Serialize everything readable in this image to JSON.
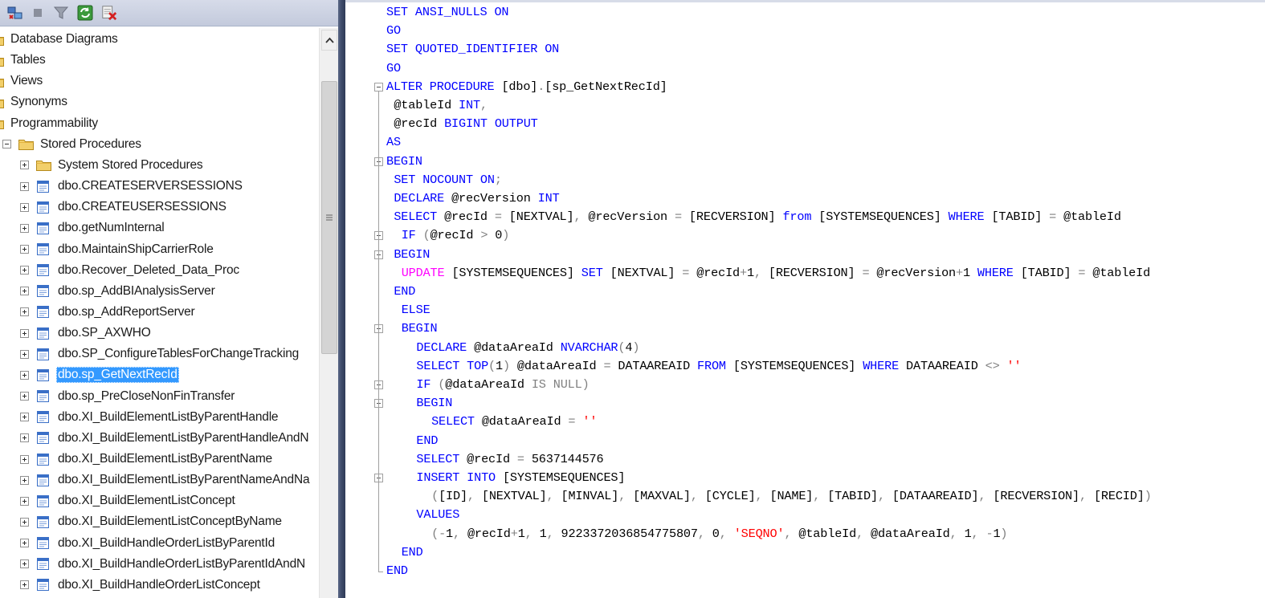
{
  "explorer": {
    "toolbar": {
      "buttons": [
        "connect-icon",
        "stop-icon",
        "filter-icon",
        "refresh-icon",
        "delete-icon"
      ]
    },
    "tree": [
      {
        "label": "Database Diagrams",
        "kind": "folder",
        "level": 0,
        "expander": "none"
      },
      {
        "label": "Tables",
        "kind": "folder",
        "level": 0,
        "expander": "none"
      },
      {
        "label": "Views",
        "kind": "folder",
        "level": 0,
        "expander": "none"
      },
      {
        "label": "Synonyms",
        "kind": "folder",
        "level": 0,
        "expander": "none"
      },
      {
        "label": "Programmability",
        "kind": "folder",
        "level": 0,
        "expander": "none"
      },
      {
        "label": "Stored Procedures",
        "kind": "folder",
        "level": 1,
        "expander": "minus"
      },
      {
        "label": "System Stored Procedures",
        "kind": "folder",
        "level": 2,
        "expander": "plus"
      },
      {
        "label": "dbo.CREATESERVERSESSIONS",
        "kind": "proc",
        "level": 2,
        "expander": "plus"
      },
      {
        "label": "dbo.CREATEUSERSESSIONS",
        "kind": "proc",
        "level": 2,
        "expander": "plus"
      },
      {
        "label": "dbo.getNumInternal",
        "kind": "proc",
        "level": 2,
        "expander": "plus"
      },
      {
        "label": "dbo.MaintainShipCarrierRole",
        "kind": "proc",
        "level": 2,
        "expander": "plus"
      },
      {
        "label": "dbo.Recover_Deleted_Data_Proc",
        "kind": "proc",
        "level": 2,
        "expander": "plus"
      },
      {
        "label": "dbo.sp_AddBIAnalysisServer",
        "kind": "proc",
        "level": 2,
        "expander": "plus"
      },
      {
        "label": "dbo.sp_AddReportServer",
        "kind": "proc",
        "level": 2,
        "expander": "plus"
      },
      {
        "label": "dbo.SP_AXWHO",
        "kind": "proc",
        "level": 2,
        "expander": "plus"
      },
      {
        "label": "dbo.SP_ConfigureTablesForChangeTracking",
        "kind": "proc",
        "level": 2,
        "expander": "plus"
      },
      {
        "label": "dbo.sp_GetNextRecId",
        "kind": "proc",
        "level": 2,
        "expander": "plus",
        "selected": true
      },
      {
        "label": "dbo.sp_PreCloseNonFinTransfer",
        "kind": "proc",
        "level": 2,
        "expander": "plus"
      },
      {
        "label": "dbo.XI_BuildElementListByParentHandle",
        "kind": "proc",
        "level": 2,
        "expander": "plus"
      },
      {
        "label": "dbo.XI_BuildElementListByParentHandleAndN",
        "kind": "proc",
        "level": 2,
        "expander": "plus"
      },
      {
        "label": "dbo.XI_BuildElementListByParentName",
        "kind": "proc",
        "level": 2,
        "expander": "plus"
      },
      {
        "label": "dbo.XI_BuildElementListByParentNameAndNa",
        "kind": "proc",
        "level": 2,
        "expander": "plus"
      },
      {
        "label": "dbo.XI_BuildElementListConcept",
        "kind": "proc",
        "level": 2,
        "expander": "plus"
      },
      {
        "label": "dbo.XI_BuildElementListConceptByName",
        "kind": "proc",
        "level": 2,
        "expander": "plus"
      },
      {
        "label": "dbo.XI_BuildHandleOrderListByParentId",
        "kind": "proc",
        "level": 2,
        "expander": "plus"
      },
      {
        "label": "dbo.XI_BuildHandleOrderListByParentIdAndN",
        "kind": "proc",
        "level": 2,
        "expander": "plus"
      },
      {
        "label": "dbo.XI_BuildHandleOrderListConcept",
        "kind": "proc",
        "level": 2,
        "expander": "plus"
      }
    ]
  },
  "editor": {
    "lines": [
      {
        "indent": 0,
        "tokens": [
          [
            "kw",
            "SET ANSI_NULLS ON"
          ]
        ]
      },
      {
        "indent": 0,
        "tokens": [
          [
            "kw",
            "GO"
          ]
        ]
      },
      {
        "indent": 0,
        "tokens": [
          [
            "kw",
            "SET QUOTED_IDENTIFIER ON"
          ]
        ]
      },
      {
        "indent": 0,
        "tokens": [
          [
            "kw",
            "GO"
          ]
        ]
      },
      {
        "indent": 0,
        "fold": true,
        "tokens": [
          [
            "kw",
            "ALTER PROCEDURE "
          ],
          [
            "tx",
            "[dbo]"
          ],
          [
            "gy",
            "."
          ],
          [
            "tx",
            "[sp_GetNextRecId]"
          ]
        ]
      },
      {
        "indent": 1,
        "tokens": [
          [
            "tx",
            "@tableId "
          ],
          [
            "kw",
            "INT"
          ],
          [
            "gy",
            ","
          ]
        ]
      },
      {
        "indent": 1,
        "tokens": [
          [
            "tx",
            "@recId "
          ],
          [
            "kw",
            "BIGINT OUTPUT"
          ]
        ]
      },
      {
        "indent": 0,
        "tokens": [
          [
            "kw",
            "AS"
          ]
        ]
      },
      {
        "indent": 0,
        "fold": true,
        "tokens": [
          [
            "kw",
            "BEGIN"
          ]
        ]
      },
      {
        "indent": 1,
        "tokens": [
          [
            "kw",
            "SET NOCOUNT ON"
          ],
          [
            "gy",
            ";"
          ]
        ]
      },
      {
        "indent": 1,
        "tokens": [
          [
            "kw",
            "DECLARE "
          ],
          [
            "tx",
            "@recVersion "
          ],
          [
            "kw",
            "INT"
          ]
        ]
      },
      {
        "indent": 1,
        "tokens": [
          [
            "kw",
            "SELECT "
          ],
          [
            "tx",
            "@recId "
          ],
          [
            "gy",
            "= "
          ],
          [
            "tx",
            "[NEXTVAL]"
          ],
          [
            "gy",
            ", "
          ],
          [
            "tx",
            "@recVersion "
          ],
          [
            "gy",
            "= "
          ],
          [
            "tx",
            "[RECVERSION] "
          ],
          [
            "kw",
            "from "
          ],
          [
            "tx",
            "[SYSTEMSEQUENCES] "
          ],
          [
            "kw",
            "WHERE "
          ],
          [
            "tx",
            "[TABID] "
          ],
          [
            "gy",
            "= "
          ],
          [
            "tx",
            "@tableId"
          ]
        ]
      },
      {
        "indent": 2,
        "fold": true,
        "tokens": [
          [
            "kw",
            "IF "
          ],
          [
            "gy",
            "("
          ],
          [
            "tx",
            "@recId "
          ],
          [
            "gy",
            "> "
          ],
          [
            "tx",
            "0"
          ],
          [
            "gy",
            ")"
          ]
        ]
      },
      {
        "indent": 1,
        "fold": true,
        "tokens": [
          [
            "kw",
            "BEGIN"
          ]
        ]
      },
      {
        "indent": 2,
        "tokens": [
          [
            "pk",
            "UPDATE "
          ],
          [
            "tx",
            "[SYSTEMSEQUENCES] "
          ],
          [
            "kw",
            "SET "
          ],
          [
            "tx",
            "[NEXTVAL] "
          ],
          [
            "gy",
            "= "
          ],
          [
            "tx",
            "@recId"
          ],
          [
            "gy",
            "+"
          ],
          [
            "tx",
            "1"
          ],
          [
            "gy",
            ", "
          ],
          [
            "tx",
            "[RECVERSION] "
          ],
          [
            "gy",
            "= "
          ],
          [
            "tx",
            "@recVersion"
          ],
          [
            "gy",
            "+"
          ],
          [
            "tx",
            "1 "
          ],
          [
            "kw",
            "WHERE "
          ],
          [
            "tx",
            "[TABID] "
          ],
          [
            "gy",
            "= "
          ],
          [
            "tx",
            "@tableId"
          ]
        ]
      },
      {
        "indent": 1,
        "tokens": [
          [
            "kw",
            "END"
          ]
        ]
      },
      {
        "indent": 2,
        "tokens": [
          [
            "kw",
            "ELSE"
          ]
        ]
      },
      {
        "indent": 2,
        "fold": true,
        "tokens": [
          [
            "kw",
            "BEGIN"
          ]
        ]
      },
      {
        "indent": 4,
        "tokens": [
          [
            "kw",
            "DECLARE "
          ],
          [
            "tx",
            "@dataAreaId "
          ],
          [
            "kw",
            "NVARCHAR"
          ],
          [
            "gy",
            "("
          ],
          [
            "tx",
            "4"
          ],
          [
            "gy",
            ")"
          ]
        ]
      },
      {
        "indent": 4,
        "tokens": [
          [
            "kw",
            "SELECT TOP"
          ],
          [
            "gy",
            "("
          ],
          [
            "tx",
            "1"
          ],
          [
            "gy",
            ") "
          ],
          [
            "tx",
            "@dataAreaId "
          ],
          [
            "gy",
            "= "
          ],
          [
            "tx",
            "DATAAREAID "
          ],
          [
            "kw",
            "FROM "
          ],
          [
            "tx",
            "[SYSTEMSEQUENCES] "
          ],
          [
            "kw",
            "WHERE "
          ],
          [
            "tx",
            "DATAAREAID "
          ],
          [
            "gy",
            "<> "
          ],
          [
            "st",
            "''"
          ]
        ]
      },
      {
        "indent": 4,
        "fold": true,
        "tokens": [
          [
            "kw",
            "IF "
          ],
          [
            "gy",
            "("
          ],
          [
            "tx",
            "@dataAreaId "
          ],
          [
            "gy",
            "IS NULL)"
          ]
        ]
      },
      {
        "indent": 4,
        "fold": true,
        "tokens": [
          [
            "kw",
            "BEGIN"
          ]
        ]
      },
      {
        "indent": 6,
        "tokens": [
          [
            "kw",
            "SELECT "
          ],
          [
            "tx",
            "@dataAreaId "
          ],
          [
            "gy",
            "= "
          ],
          [
            "st",
            "''"
          ]
        ]
      },
      {
        "indent": 4,
        "tokens": [
          [
            "kw",
            "END"
          ]
        ]
      },
      {
        "indent": 4,
        "tokens": [
          [
            "kw",
            "SELECT "
          ],
          [
            "tx",
            "@recId "
          ],
          [
            "gy",
            "= "
          ],
          [
            "tx",
            "5637144576"
          ]
        ]
      },
      {
        "indent": 4,
        "fold": true,
        "tokens": [
          [
            "kw",
            "INSERT INTO "
          ],
          [
            "tx",
            "[SYSTEMSEQUENCES]"
          ]
        ]
      },
      {
        "indent": 6,
        "tokens": [
          [
            "gy",
            "("
          ],
          [
            "tx",
            "[ID]"
          ],
          [
            "gy",
            ", "
          ],
          [
            "tx",
            "[NEXTVAL]"
          ],
          [
            "gy",
            ", "
          ],
          [
            "tx",
            "[MINVAL]"
          ],
          [
            "gy",
            ", "
          ],
          [
            "tx",
            "[MAXVAL]"
          ],
          [
            "gy",
            ", "
          ],
          [
            "tx",
            "[CYCLE]"
          ],
          [
            "gy",
            ", "
          ],
          [
            "tx",
            "[NAME]"
          ],
          [
            "gy",
            ", "
          ],
          [
            "tx",
            "[TABID]"
          ],
          [
            "gy",
            ", "
          ],
          [
            "tx",
            "[DATAAREAID]"
          ],
          [
            "gy",
            ", "
          ],
          [
            "tx",
            "[RECVERSION]"
          ],
          [
            "gy",
            ", "
          ],
          [
            "tx",
            "[RECID]"
          ],
          [
            "gy",
            ")"
          ]
        ]
      },
      {
        "indent": 4,
        "tokens": [
          [
            "kw",
            "VALUES"
          ]
        ]
      },
      {
        "indent": 6,
        "tokens": [
          [
            "gy",
            "("
          ],
          [
            "gy",
            "-"
          ],
          [
            "tx",
            "1"
          ],
          [
            "gy",
            ", "
          ],
          [
            "tx",
            "@recId"
          ],
          [
            "gy",
            "+"
          ],
          [
            "tx",
            "1"
          ],
          [
            "gy",
            ", "
          ],
          [
            "tx",
            "1"
          ],
          [
            "gy",
            ", "
          ],
          [
            "tx",
            "9223372036854775807"
          ],
          [
            "gy",
            ", "
          ],
          [
            "tx",
            "0"
          ],
          [
            "gy",
            ", "
          ],
          [
            "st",
            "'SEQNO'"
          ],
          [
            "gy",
            ", "
          ],
          [
            "tx",
            "@tableId"
          ],
          [
            "gy",
            ", "
          ],
          [
            "tx",
            "@dataAreaId"
          ],
          [
            "gy",
            ", "
          ],
          [
            "tx",
            "1"
          ],
          [
            "gy",
            ", "
          ],
          [
            "gy",
            "-"
          ],
          [
            "tx",
            "1"
          ],
          [
            "gy",
            ")"
          ]
        ]
      },
      {
        "indent": 2,
        "tokens": [
          [
            "kw",
            "END"
          ]
        ]
      },
      {
        "indent": 0,
        "tokens": [
          [
            "kw",
            "END"
          ]
        ]
      }
    ]
  }
}
